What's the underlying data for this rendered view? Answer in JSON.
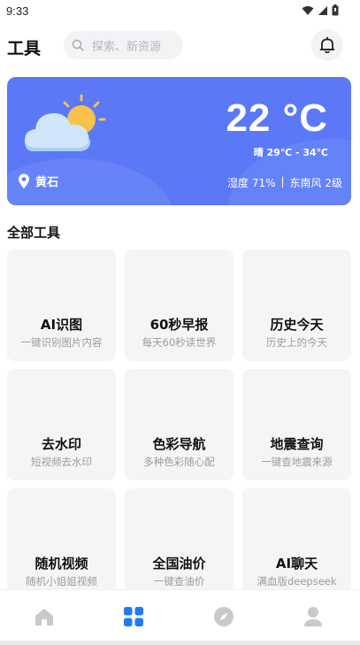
{
  "status": {
    "time": "9:33"
  },
  "header": {
    "title": "工具",
    "search_placeholder": "探索、新资源"
  },
  "weather": {
    "temperature": "22 °C",
    "condition_range": "晴 29℃ - 34℃",
    "location": "黄石",
    "humidity": "湿度 71%",
    "separator": "|",
    "wind": "东南风 2级"
  },
  "tools_section": {
    "title": "全部工具"
  },
  "tools": [
    {
      "name": "AI识图",
      "desc": "一键识别图片内容"
    },
    {
      "name": "60秒早报",
      "desc": "每天60秒读世界"
    },
    {
      "name": "历史今天",
      "desc": "历史上的今天"
    },
    {
      "name": "去水印",
      "desc": "短视频去水印"
    },
    {
      "name": "色彩导航",
      "desc": "多种色彩随心配"
    },
    {
      "name": "地震查询",
      "desc": "一键查地震来源"
    },
    {
      "name": "随机视频",
      "desc": "随机小姐姐视频"
    },
    {
      "name": "全国油价",
      "desc": "一键查油价"
    },
    {
      "name": "AI聊天",
      "desc": "满血版deepseek"
    }
  ],
  "tabbar": {
    "active_index": 1,
    "accent": "#1e7bf2",
    "inactive": "#c8c9cc"
  }
}
